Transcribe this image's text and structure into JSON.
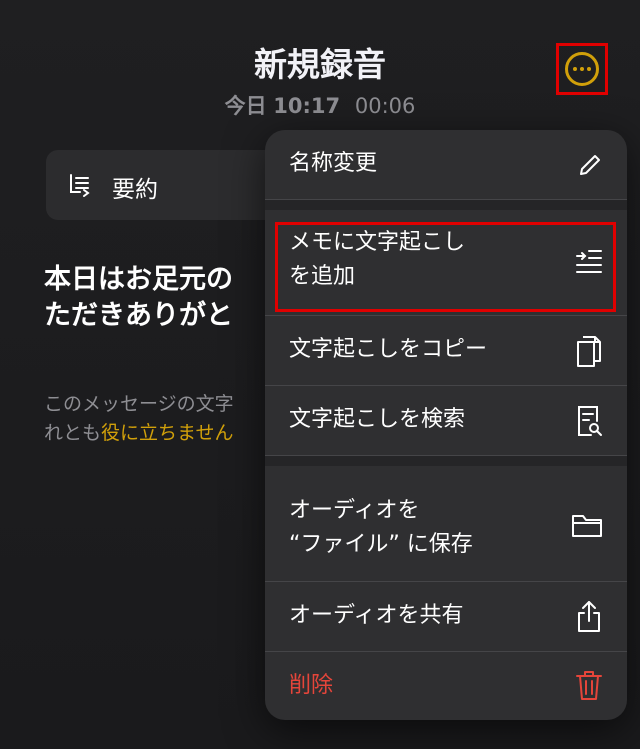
{
  "header": {
    "title": "新規録音",
    "date": "今日",
    "time": "10:17",
    "duration": "00:06"
  },
  "summary": {
    "label": "要約"
  },
  "transcript": {
    "line1": "本日はお足元の",
    "line2": "ただきありがと"
  },
  "feedback": {
    "line1": "このメッセージの文字",
    "line2_prefix": "れとも",
    "line2_link": "役に立ちません"
  },
  "menu": {
    "items": [
      {
        "label": "名称変更",
        "icon": "pencil-icon"
      },
      {
        "label_line1": "メモに文字起こし",
        "label_line2": "を追加",
        "icon": "add-transcript-icon"
      },
      {
        "label": "文字起こしをコピー",
        "icon": "copy-icon"
      },
      {
        "label": "文字起こしを検索",
        "icon": "search-document-icon"
      },
      {
        "label_line1": "オーディオを",
        "label_line2": "“ファイル” に保存",
        "icon": "folder-icon"
      },
      {
        "label": "オーディオを共有",
        "icon": "share-icon"
      },
      {
        "label": "削除",
        "icon": "trash-icon"
      }
    ]
  },
  "colors": {
    "accent": "#d1a00a",
    "destructive": "#e5453a",
    "highlight": "#e00000"
  }
}
